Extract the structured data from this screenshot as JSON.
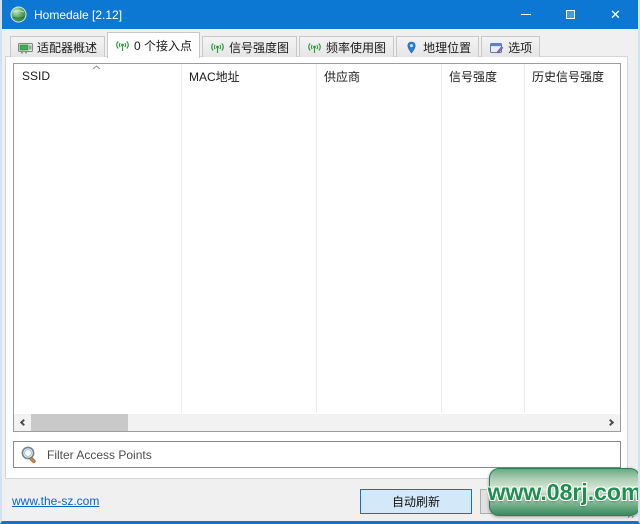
{
  "window": {
    "title": "Homedale [2.12]"
  },
  "tabs": [
    {
      "label": "适配器概述",
      "icon": "network-adapter-icon",
      "selected": false
    },
    {
      "label": "0 个接入点",
      "icon": "antenna-icon",
      "selected": true
    },
    {
      "label": "信号强度图",
      "icon": "antenna-icon",
      "selected": false
    },
    {
      "label": "频率使用图",
      "icon": "antenna-icon",
      "selected": false
    },
    {
      "label": "地理位置",
      "icon": "map-pin-icon",
      "selected": false
    },
    {
      "label": "选项",
      "icon": "options-icon",
      "selected": false
    }
  ],
  "table": {
    "columns": [
      "SSID",
      "MAC地址",
      "供应商",
      "信号强度",
      "历史信号强度"
    ],
    "sort": {
      "column": "SSID",
      "direction": "ascending"
    },
    "rows": []
  },
  "filter": {
    "placeholder": "Filter Access Points",
    "value": ""
  },
  "footer": {
    "website_link": "www.the-sz.com",
    "auto_refresh_label": "自动刷新"
  },
  "watermark": {
    "text": "www.08rj.com"
  },
  "icons": {
    "close_glyph": "✕"
  },
  "colors": {
    "titlebar_blue": "#0c78d4",
    "accent_blue": "#0078d7",
    "tab_icon_green": "#2e9e3a",
    "pin_blue": "#2a7fd4",
    "watermark_green": "#1d8f4f",
    "link_blue": "#0a64c8"
  }
}
